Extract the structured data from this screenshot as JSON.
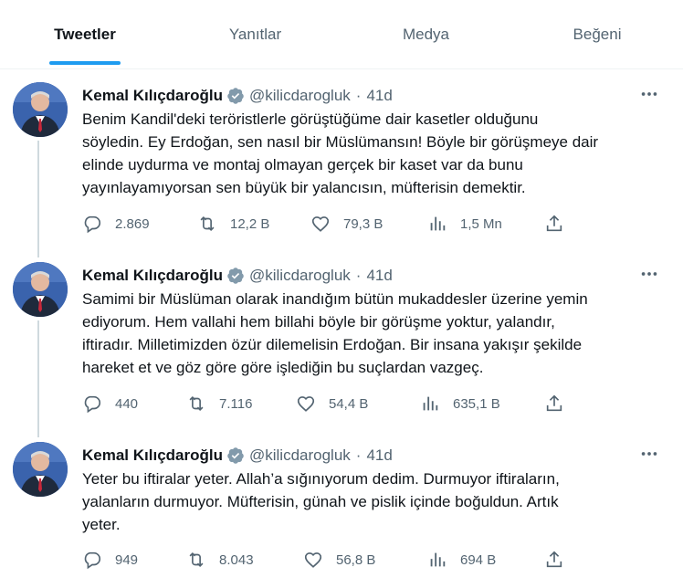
{
  "tabs": [
    {
      "label": "Tweetler",
      "active": true
    },
    {
      "label": "Yanıtlar",
      "active": false
    },
    {
      "label": "Medya",
      "active": false
    },
    {
      "label": "Beğeni",
      "active": false
    }
  ],
  "colors": {
    "accent": "#1d9bf0",
    "muted": "#536471",
    "text": "#0f1419",
    "thread_line": "#cfd9de"
  },
  "icons": {
    "reply": "reply-icon",
    "retweet": "retweet-icon",
    "like": "like-icon",
    "views": "views-icon",
    "share": "share-icon",
    "verified": "verified-badge-icon",
    "more": "more-icon"
  },
  "tweets": [
    {
      "author": "Kemal Kılıçdaroğlu",
      "handle": "@kilicdarogluk",
      "time": "41d",
      "lines": [
        "Benim Kandil'deki teröristlerle görüştüğüme dair kasetler olduğunu",
        "söyledin. Ey Erdoğan, sen nasıl bir Müslümansın! Böyle bir görüşmeye dair",
        "elinde uydurma ve montaj olmayan gerçek bir kaset var da bunu",
        "yayınlayamıyorsan sen büyük bir yalancısın, müfterisin demektir."
      ],
      "replies": "2.869",
      "retweets": "12,2 B",
      "likes": "79,3 B",
      "views": "1,5 Mn"
    },
    {
      "author": "Kemal Kılıçdaroğlu",
      "handle": "@kilicdarogluk",
      "time": "41d",
      "lines": [
        "Samimi bir Müslüman olarak inandığım bütün mukaddesler üzerine yemin",
        "ediyorum. Hem vallahi hem billahi böyle bir görüşme yoktur, yalandır,",
        "iftiradır. Milletimizden özür dilemelisin Erdoğan. Bir insana yakışır şekilde",
        "hareket et ve göz göre göre işlediğin bu suçlardan vazgeç."
      ],
      "replies": "440",
      "retweets": "7.116",
      "likes": "54,4 B",
      "views": "635,1 B"
    },
    {
      "author": "Kemal Kılıçdaroğlu",
      "handle": "@kilicdarogluk",
      "time": "41d",
      "lines": [
        "Yeter bu iftiralar yeter. Allah’a sığınıyorum dedim. Durmuyor iftiraların,",
        "yalanların durmuyor. Müfterisin, günah ve pislik içinde boğuldun. Artık",
        "yeter."
      ],
      "replies": "949",
      "retweets": "8.043",
      "likes": "56,8 B",
      "views": "694 B"
    }
  ]
}
